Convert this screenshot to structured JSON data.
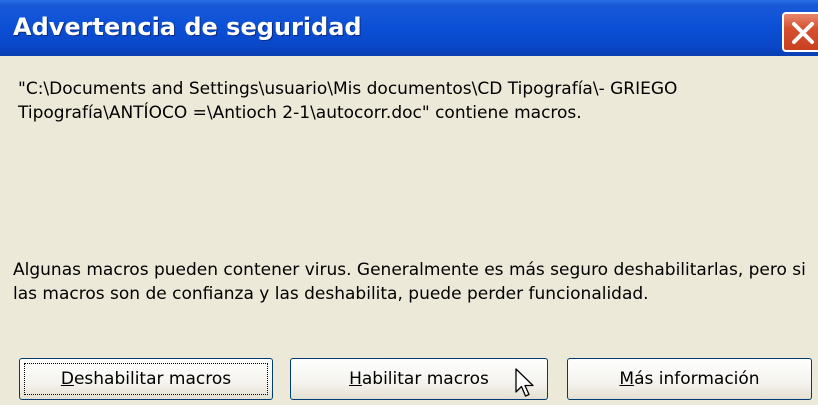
{
  "window": {
    "title": "Advertencia de seguridad"
  },
  "message": {
    "path_line": "\"C:\\Documents and Settings\\usuario\\Mis documentos\\CD Tipografía\\- GRIEGO Tipografía\\ANTÍOCO =\\Antioch 2-1\\autocorr.doc\" contiene macros.",
    "warning": "Algunas macros pueden contener virus. Generalmente es más seguro deshabilitarlas, pero si las macros son de confianza y las deshabilita, puede perder funcionalidad."
  },
  "buttons": {
    "disable": {
      "accel": "D",
      "rest": "eshabilitar macros"
    },
    "enable": {
      "accel": "H",
      "rest": "abilitar macros"
    },
    "more": {
      "accel": "M",
      "rest": "ás información"
    }
  },
  "icons": {
    "close": "close-icon",
    "cursor": "mouse-pointer-icon"
  },
  "colors": {
    "titlebar": "#0a4fd6",
    "close": "#d6502f",
    "dialog_bg": "#ece9d8"
  }
}
